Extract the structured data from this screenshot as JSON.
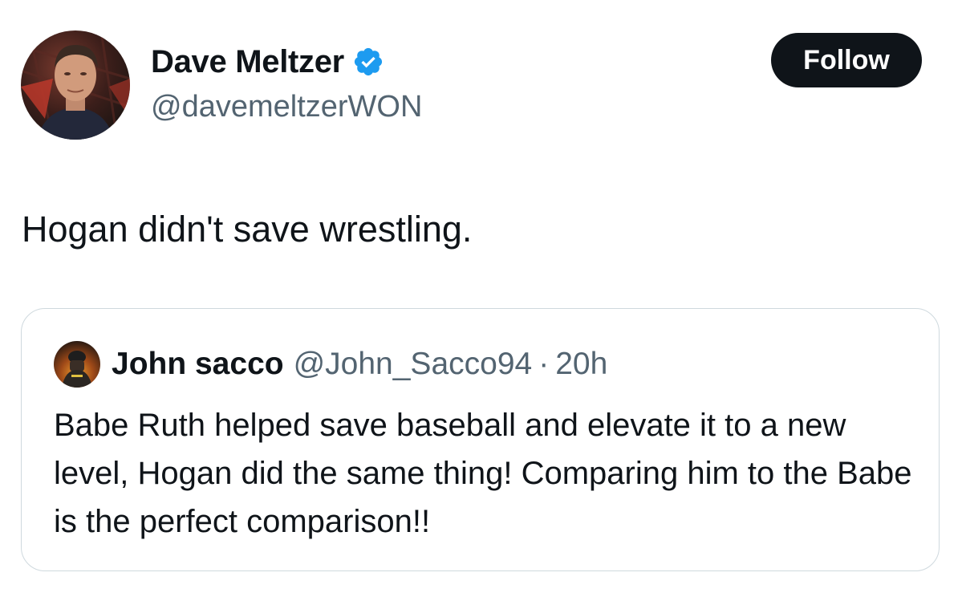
{
  "author": {
    "display_name": "Dave Meltzer",
    "handle": "@davemeltzerWON",
    "verified": true,
    "avatar_icon": "profile-photo"
  },
  "follow_button": {
    "label": "Follow"
  },
  "tweet": {
    "text": "Hogan didn't save wrestling."
  },
  "quoted_tweet": {
    "display_name": "John sacco",
    "handle": "@John_Sacco94",
    "separator": "·",
    "time": "20h",
    "avatar_icon": "profile-photo",
    "text": "Babe Ruth helped save baseball and elevate it to a new level, Hogan did the same thing! Comparing him to the Babe is the perfect comparison!!"
  },
  "colors": {
    "text_primary": "#0f1419",
    "text_secondary": "#536471",
    "verified_blue": "#1d9bf0",
    "follow_bg": "#0f1419",
    "border": "#cfd9de"
  }
}
